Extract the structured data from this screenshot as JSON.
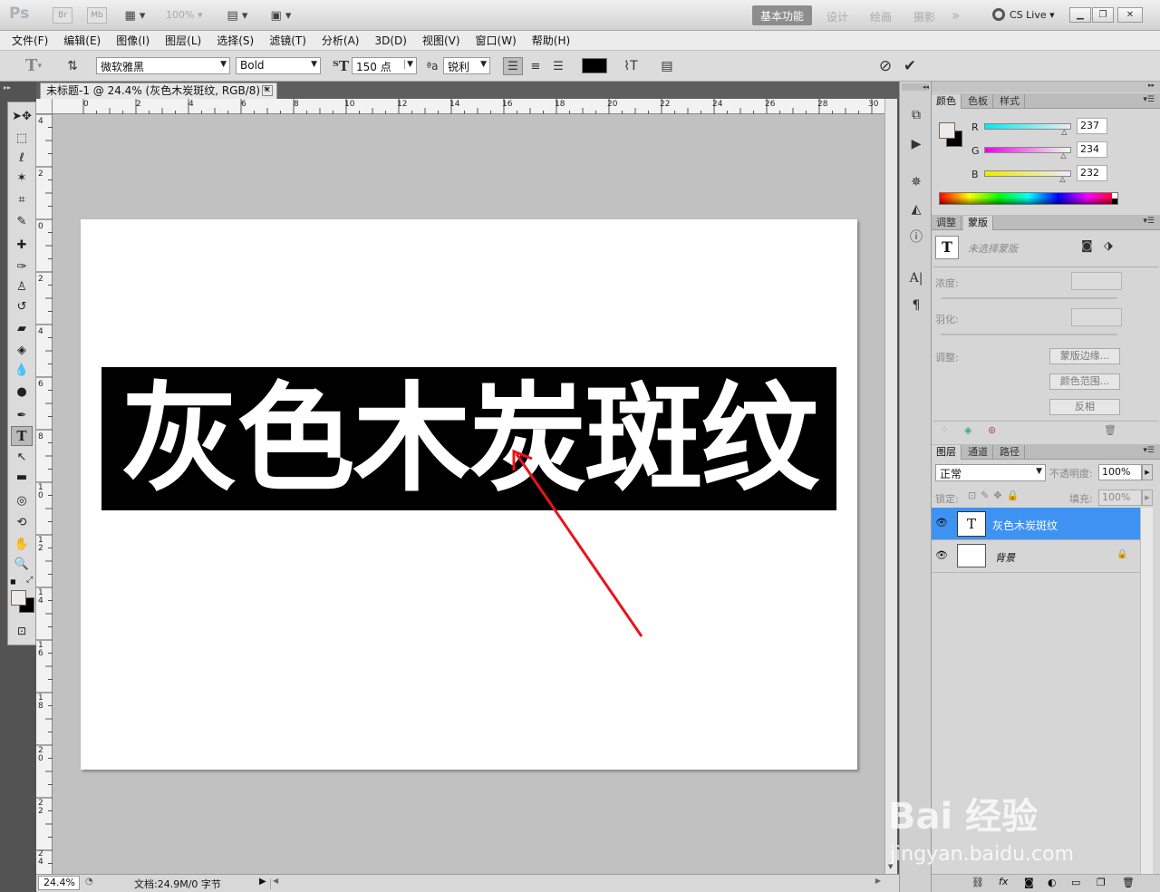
{
  "app": {
    "logo": "Ps",
    "bridge_btn": "Br",
    "minibridge_btn": "Mb",
    "zoom_level": "100%",
    "workspaces": [
      "基本功能",
      "设计",
      "绘画",
      "摄影"
    ],
    "more_workspaces": "»",
    "cslive": "CS Live"
  },
  "menu": [
    "文件(F)",
    "编辑(E)",
    "图像(I)",
    "图层(L)",
    "选择(S)",
    "滤镜(T)",
    "分析(A)",
    "3D(D)",
    "视图(V)",
    "窗口(W)",
    "帮助(H)"
  ],
  "options": {
    "font_family": "微软雅黑",
    "font_style": "Bold",
    "font_size": "150 点",
    "aa_label": "ªa",
    "antialias": "锐利",
    "text_color": "#000000"
  },
  "document": {
    "tab_title": "未标题-1 @ 24.4% (灰色木炭斑纹, RGB/8) *",
    "headline": "灰色木炭斑纹",
    "ruler_top": [
      "0",
      "2",
      "4",
      "6",
      "8",
      "10",
      "12",
      "14",
      "16",
      "18",
      "20",
      "22",
      "24",
      "26",
      "28",
      "30"
    ],
    "ruler_left": [
      "4",
      "2",
      "0",
      "2",
      "4",
      "6",
      "8",
      "10",
      "12",
      "14",
      "16",
      "18",
      "20",
      "22",
      "24"
    ]
  },
  "status": {
    "zoom": "24.4%",
    "doc_info": "文档:24.9M/0 字节"
  },
  "color_panel": {
    "tabs": [
      "颜色",
      "色板",
      "样式"
    ],
    "r_label": "R",
    "g_label": "G",
    "b_label": "B",
    "r": "237",
    "g": "234",
    "b": "232",
    "r_frac": 0.93,
    "g_frac": 0.92,
    "b_frac": 0.91
  },
  "masks_panel": {
    "tabs": [
      "调整",
      "蒙版"
    ],
    "no_mask": "未选择蒙版",
    "density_label": "浓度:",
    "feather_label": "羽化:",
    "refine_label": "调整:",
    "mask_edge_btn": "蒙版边缘...",
    "color_range_btn": "颜色范围...",
    "invert_btn": "反相"
  },
  "layers_panel": {
    "tabs": [
      "图层",
      "通道",
      "路径"
    ],
    "blend_mode": "正常",
    "opacity_label": "不透明度:",
    "opacity": "100%",
    "lock_label": "锁定:",
    "fill_label": "填充:",
    "fill": "100%",
    "layers": [
      {
        "name": "灰色木炭斑纹",
        "kind": "text-layer",
        "thumb": "T"
      },
      {
        "name": "背景",
        "kind": "background-layer",
        "thumb": ""
      }
    ],
    "fx_label": "fx"
  },
  "watermark": {
    "brand": "Bai 经验",
    "url": "jingyan.baidu.com"
  },
  "colors": {
    "accent_selection": "#3e92f2",
    "annotation_arrow": "#e8141a"
  }
}
